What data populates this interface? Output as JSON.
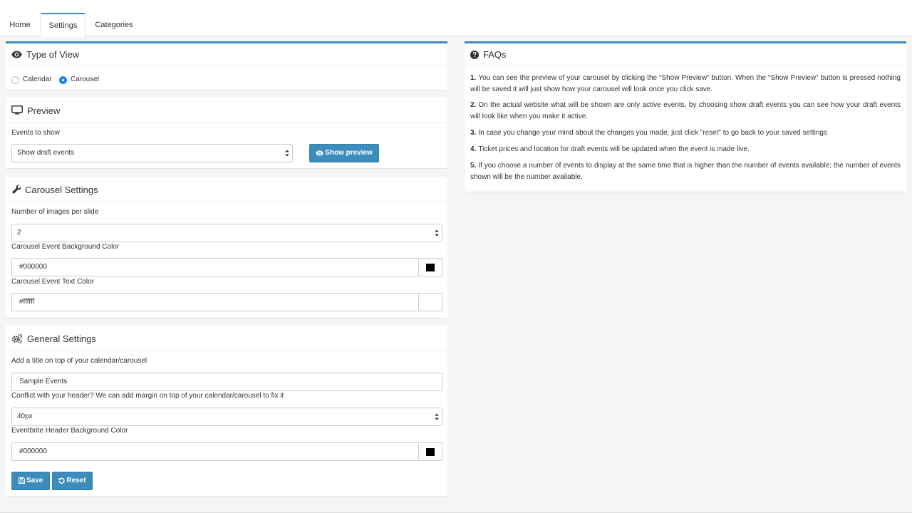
{
  "tabs": [
    {
      "label": "Home"
    },
    {
      "label": "Settings"
    },
    {
      "label": "Categories"
    }
  ],
  "active_tab": "Settings",
  "type_of_view": {
    "title": "Type of View",
    "options": [
      {
        "label": "Calendar",
        "checked": false
      },
      {
        "label": "Carousel",
        "checked": true
      }
    ]
  },
  "preview": {
    "title": "Preview",
    "events_label": "Events to show",
    "events_value": "Show draft events",
    "button_label": "Show preview"
  },
  "carousel_settings": {
    "title": "Carousel Settings",
    "images_label": "Number of images per slide",
    "images_value": "2",
    "bg_color_label": "Carousel Event Background Color",
    "bg_color_value": "#000000",
    "text_color_label": "Carousel Event Text Color",
    "text_color_value": "#ffffff"
  },
  "general_settings": {
    "title": "General Settings",
    "title_label": "Add a title on top of your calendar/carousel",
    "title_value": "Sample Events",
    "margin_label": "Conflict with your header? We can add margin on top of your calendar/carousel to fix it",
    "margin_value": "40px",
    "header_color_label": "Eventbrite Header Background Color",
    "header_color_value": "#000000",
    "save_label": "Save",
    "reset_label": "Reset"
  },
  "faqs": {
    "title": "FAQs",
    "items": [
      {
        "num": "1.",
        "text": "You can see the preview of your carousel by clicking the “Show Preview” button. When the “Show Preview” button is pressed nothing will be saved it will just show how your carousel will look once you click save."
      },
      {
        "num": "2.",
        "text": "On the actual website what will be shown are only active events, by choosing show draft events you can see how your draft events will look like when you make it active."
      },
      {
        "num": "3.",
        "text": "In case you change your mind about the changes you made, just click \"reset\" to go back to your saved settings"
      },
      {
        "num": "4.",
        "text": "Ticket prices and location for draft events will be updated when the event is made live."
      },
      {
        "num": "5.",
        "text": "If you choose a number of events to display at the same time that is higher than the number of events available; the number of events shown will be the number available."
      }
    ]
  },
  "colors": {
    "accent": "#3c8dbc",
    "radio_checked": "#1e88e5"
  }
}
